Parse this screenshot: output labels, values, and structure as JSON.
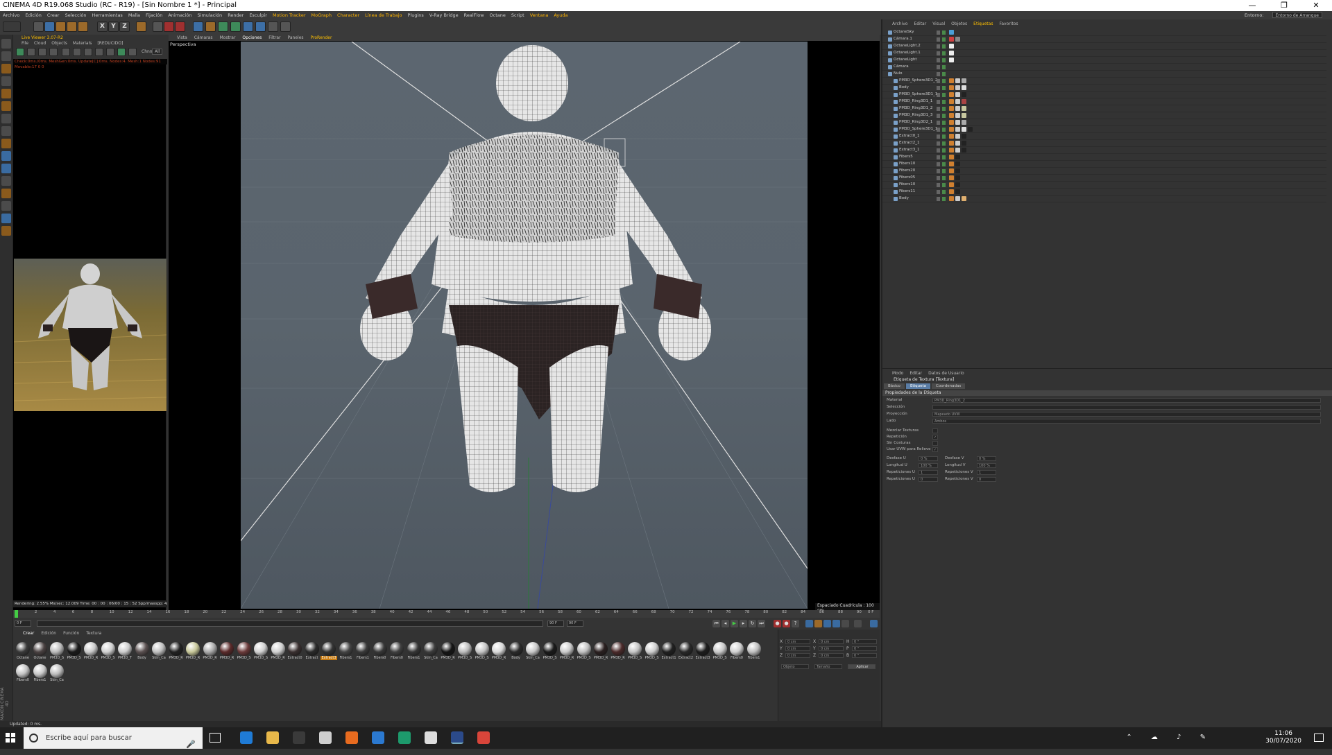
{
  "window": {
    "title": "CINEMA 4D R19.068 Studio (RC - R19) - [Sin Nombre 1 *] - Principal",
    "controls": [
      "—",
      "❐",
      "✕"
    ]
  },
  "menubar": {
    "items": [
      "Archivo",
      "Edición",
      "Crear",
      "Selección",
      "Herramientas",
      "Malla",
      "Fijación",
      "Animación",
      "Simulación",
      "Render",
      "Esculpir",
      "Motion Tracker",
      "MoGraph",
      "Character",
      "Línea de Trabajo",
      "Plugins",
      "V-Ray Bridge",
      "RealFlow",
      "Octane",
      "Script",
      "Ventana",
      "Ayuda"
    ],
    "entorno_label": "Entorno:",
    "entorno_value": "Entorno de Arranque"
  },
  "toolbar": {
    "xyz": [
      "X",
      "Y",
      "Z"
    ]
  },
  "live_viewer": {
    "title": "Live Viewer 3.07-R2",
    "menu": [
      "File",
      "Cloud",
      "Objects",
      "Materials",
      "[REDUCIDO]"
    ],
    "channel_label": "Chnn",
    "channel_value": "All",
    "status": "Check:0ms./0ms. MeshGen:0ms. Update[C]:0ms. Nodes:4. Mesh:1 Nodes:91 Movable:17  0 0",
    "footer": "Rendering: 2.55%    Ms/sec: 12.009    Time: 00 : 00 : 06/00 : 15 : 52    Spp/maxspp: 4/64  Tri:0"
  },
  "viewport": {
    "menu": [
      "Vista",
      "Cámaras",
      "Mostrar",
      "Opciones",
      "Filtrar",
      "Paneles",
      "ProRender"
    ],
    "selected_menu": "Opciones",
    "camera_label": "Perspectiva",
    "grid_label": "Espaciado Cuadrícula : 100 cm"
  },
  "timeline": {
    "ticks": [
      "0",
      "2",
      "4",
      "6",
      "8",
      "10",
      "12",
      "14",
      "16",
      "18",
      "20",
      "22",
      "24",
      "26",
      "28",
      "30",
      "32",
      "34",
      "36",
      "38",
      "40",
      "42",
      "44",
      "46",
      "48",
      "50",
      "52",
      "54",
      "56",
      "58",
      "60",
      "62",
      "64",
      "66",
      "68",
      "70",
      "72",
      "74",
      "76",
      "78",
      "80",
      "82",
      "84",
      "86",
      "88",
      "90"
    ],
    "end_label": "0 F",
    "start_field": "0 F",
    "current_field": "0 F",
    "end_field": "90 F",
    "max_field": "90 F"
  },
  "materials": {
    "menu": [
      "Crear",
      "Edición",
      "Función",
      "Textura"
    ],
    "selected_menu": "Crear",
    "items": [
      {
        "label": "Octane",
        "color": "#3a3a3a"
      },
      {
        "label": "Octane",
        "color": "#4a4242"
      },
      {
        "label": "PM3D_S",
        "color": "#bbbbbb"
      },
      {
        "label": "PM3D_S",
        "color": "#1a1a1a"
      },
      {
        "label": "PM3D_R",
        "color": "#c9c9c9"
      },
      {
        "label": "PM3D_S",
        "color": "#d0d0d0"
      },
      {
        "label": "PM3D_T",
        "color": "#cccccc"
      },
      {
        "label": "Body",
        "color": "#5a5050"
      },
      {
        "label": "Skin_Ca",
        "color": "#c0c0c0"
      },
      {
        "label": "PM3D_R",
        "color": "#222222"
      },
      {
        "label": "PM3D_R",
        "color": "#c8c89a"
      },
      {
        "label": "PM3D_R",
        "color": "#aaaaaa"
      },
      {
        "label": "PM3D_R",
        "color": "#5a2a2a"
      },
      {
        "label": "PM3D_S",
        "color": "#6a3a3a"
      },
      {
        "label": "PM3D_S",
        "color": "#d0d0d0"
      },
      {
        "label": "PM3D_R",
        "color": "#cfcfcf"
      },
      {
        "label": "Extract0",
        "color": "#3a3030"
      },
      {
        "label": "Extract",
        "color": "#2a2a2a"
      },
      {
        "label": "Extract3",
        "color": "#333333"
      },
      {
        "label": "Fibers1",
        "color": "#444444"
      },
      {
        "label": "Fibers1",
        "color": "#3a3a3a"
      },
      {
        "label": "Fibers0",
        "color": "#383838"
      },
      {
        "label": "Fibers0",
        "color": "#404040"
      },
      {
        "label": "Fibers1",
        "color": "#363636"
      },
      {
        "label": "Skin_Ca",
        "color": "#3c3c3c"
      },
      {
        "label": "PM3D_R",
        "color": "#151515"
      },
      {
        "label": "PM3D_S",
        "color": "#bdbdbd"
      },
      {
        "label": "PM3D_S",
        "color": "#c5c5c5"
      },
      {
        "label": "PM3D_R",
        "color": "#d8d8d8"
      },
      {
        "label": "Body",
        "color": "#2a2a2a"
      },
      {
        "label": "Skin_Ca",
        "color": "#c8c8c8"
      },
      {
        "label": "PM3D_S",
        "color": "#1a1a1a"
      },
      {
        "label": "PM3D_R",
        "color": "#cacaca"
      },
      {
        "label": "PM3D_S",
        "color": "#c0c0c0"
      },
      {
        "label": "PM3D_R",
        "color": "#2a2020"
      },
      {
        "label": "PM3D_R",
        "color": "#4a2a2a"
      },
      {
        "label": "PM3D_S",
        "color": "#c4c4c4"
      },
      {
        "label": "PM3D_S",
        "color": "#cdcdcd"
      },
      {
        "label": "Extract1",
        "color": "#202020"
      },
      {
        "label": "Extract2",
        "color": "#282828"
      },
      {
        "label": "Extract3",
        "color": "#1c1c1c"
      },
      {
        "label": "PM3D_S",
        "color": "#c8c8c8"
      },
      {
        "label": "Fibers0",
        "color": "#d0d0d0"
      },
      {
        "label": "Fibers1",
        "color": "#c0c0c0"
      },
      {
        "label": "Fibers0",
        "color": "#c4c4c4"
      },
      {
        "label": "Fibers1",
        "color": "#c8c8c8"
      },
      {
        "label": "Skin_Ca",
        "color": "#bcbcbc"
      }
    ],
    "selected_index": 18
  },
  "coords": {
    "rows": [
      {
        "axis": "X",
        "pos": "0 cm",
        "axis2": "X",
        "size": "0 cm",
        "axis3": "H",
        "rot": "0 °"
      },
      {
        "axis": "Y",
        "pos": "0 cm",
        "axis2": "Y",
        "size": "0 cm",
        "axis3": "P",
        "rot": "0 °"
      },
      {
        "axis": "Z",
        "pos": "0 cm",
        "axis2": "Z",
        "size": "0 cm",
        "axis3": "B",
        "rot": "0 °"
      }
    ],
    "mode1": "Objeto",
    "mode2": "Tamaño",
    "apply": "Aplicar"
  },
  "object_manager": {
    "menu": [
      "Archivo",
      "Editar",
      "Visual",
      "Objetos",
      "Etiquetas",
      "Favoritos"
    ],
    "selected_menu": "Etiquetas",
    "objects": [
      {
        "name": "OctaneSky",
        "indent": 0,
        "tags": [
          "#4aa0d8"
        ]
      },
      {
        "name": "Cámara.1",
        "indent": 0,
        "tags": [
          "#d04040",
          "#888888"
        ]
      },
      {
        "name": "OctaneLight.2",
        "indent": 0,
        "tags": [
          "#eeeeee"
        ]
      },
      {
        "name": "OctaneLight.1",
        "indent": 0,
        "tags": [
          "#eeeeee"
        ]
      },
      {
        "name": "OctaneLight",
        "indent": 0,
        "tags": [
          "#eeeeee"
        ]
      },
      {
        "name": "Cámara",
        "indent": 0,
        "tags": []
      },
      {
        "name": "Nulo",
        "indent": 0,
        "tags": []
      },
      {
        "name": "PM3D_Sphere3D1_2",
        "indent": 1,
        "tags": [
          "#d08030",
          "#cccccc",
          "#aaaaaa"
        ]
      },
      {
        "name": "Body",
        "indent": 1,
        "tags": [
          "#d08030",
          "#cccccc",
          "#dddddd"
        ]
      },
      {
        "name": "PM3D_Sphere3D1_1",
        "indent": 1,
        "tags": [
          "#d08030",
          "#cccccc",
          "#222222"
        ]
      },
      {
        "name": "PM3D_Ring3D1_1",
        "indent": 1,
        "tags": [
          "#d08030",
          "#cccccc",
          "#aa4444"
        ]
      },
      {
        "name": "PM3D_Ring3D1_2",
        "indent": 1,
        "tags": [
          "#d08030",
          "#cccccc",
          "#c8c8a0"
        ]
      },
      {
        "name": "PM3D_Ring3D1_3",
        "indent": 1,
        "tags": [
          "#d08030",
          "#cccccc",
          "#c8c8a0"
        ]
      },
      {
        "name": "PM3D_Ring3D2_1",
        "indent": 1,
        "tags": [
          "#d08030",
          "#cccccc",
          "#aaaaaa"
        ]
      },
      {
        "name": "PM3D_Sphere3D1_1",
        "indent": 1,
        "tags": [
          "#d08030",
          "#cccccc",
          "#dddddd",
          "#222222"
        ]
      },
      {
        "name": "Extract0_1",
        "indent": 1,
        "tags": [
          "#d08030",
          "#cccccc",
          "#222222"
        ]
      },
      {
        "name": "Extract2_1",
        "indent": 1,
        "tags": [
          "#d08030",
          "#cccccc",
          "#222222"
        ]
      },
      {
        "name": "Extract3_1",
        "indent": 1,
        "tags": [
          "#d08030",
          "#cccccc",
          "#222222"
        ]
      },
      {
        "name": "Fibers5",
        "indent": 1,
        "tags": [
          "#d08030",
          "#222222"
        ]
      },
      {
        "name": "Fibers10",
        "indent": 1,
        "tags": [
          "#d08030",
          "#222222"
        ]
      },
      {
        "name": "Fibers20",
        "indent": 1,
        "tags": [
          "#d08030",
          "#222222"
        ]
      },
      {
        "name": "Fibers05",
        "indent": 1,
        "tags": [
          "#d08030",
          "#222222"
        ]
      },
      {
        "name": "Fibers10",
        "indent": 1,
        "tags": [
          "#d08030",
          "#222222"
        ]
      },
      {
        "name": "Fibers11",
        "indent": 1,
        "tags": [
          "#d08030",
          "#222222"
        ]
      },
      {
        "name": "Body",
        "indent": 1,
        "tags": [
          "#d08030",
          "#cccccc",
          "#e0b070"
        ]
      }
    ]
  },
  "attributes": {
    "menu": [
      "Modo",
      "Editar",
      "Datos de Usuario"
    ],
    "title": "Etiqueta de Textura [Textura]",
    "tabs": [
      "Básico",
      "Etiqueta",
      "Coordenadas"
    ],
    "selected_tab": "Etiqueta",
    "section": "Propiedades de la Etiqueta",
    "fields": [
      {
        "label": "Material",
        "value": "PM3D_Ring3D1_2"
      },
      {
        "label": "Selección",
        "value": ""
      },
      {
        "label": "Proyección",
        "value": "Mapeado UVW"
      },
      {
        "label": "Lado",
        "value": "Ambos"
      }
    ],
    "checks": [
      {
        "label": "Mezclar Texturas",
        "value": ""
      },
      {
        "label": "Repetición",
        "value": "✓"
      },
      {
        "label": "Sin Costuras",
        "value": ""
      },
      {
        "label": "Usar UVW para Relieve",
        "value": "✓"
      }
    ],
    "pairs": [
      {
        "l1": "Desfase U",
        "v1": "0 %",
        "l2": "Desfase V",
        "v2": "0 %"
      },
      {
        "l1": "Longitud U",
        "v1": "100 %",
        "l2": "Longitud V",
        "v2": "100 %"
      },
      {
        "l1": "Repeticiones U",
        "v1": "1",
        "l2": "Repeticiones V",
        "v2": "1"
      },
      {
        "l1": "Repeticiones U",
        "v1": "0",
        "l2": "Repeticiones V",
        "v2": "0"
      }
    ]
  },
  "statusbar": {
    "text": "Updated: 0 ms.",
    "logo": "MAXON CINEMA 4D"
  },
  "taskbar": {
    "search_placeholder": "Escribe aquí para buscar",
    "time": "11:06",
    "date": "30/07/2020",
    "apps": [
      {
        "name": "edge-app-icon",
        "color": "#1f7bd6"
      },
      {
        "name": "file-explorer-icon",
        "color": "#e8b84a"
      },
      {
        "name": "store-icon",
        "color": "#3a3a3a"
      },
      {
        "name": "mail-icon",
        "color": "#cfcfcf"
      },
      {
        "name": "firefox-icon",
        "color": "#e86b1f"
      },
      {
        "name": "wordpad-icon",
        "color": "#2b79d0"
      },
      {
        "name": "app-green-icon",
        "color": "#1d9a6c"
      },
      {
        "name": "app-paint-icon",
        "color": "#dddddd"
      },
      {
        "name": "cinema4d-icon",
        "color": "#2b4a8a"
      },
      {
        "name": "chrome-icon",
        "color": "#d8453a"
      }
    ]
  }
}
